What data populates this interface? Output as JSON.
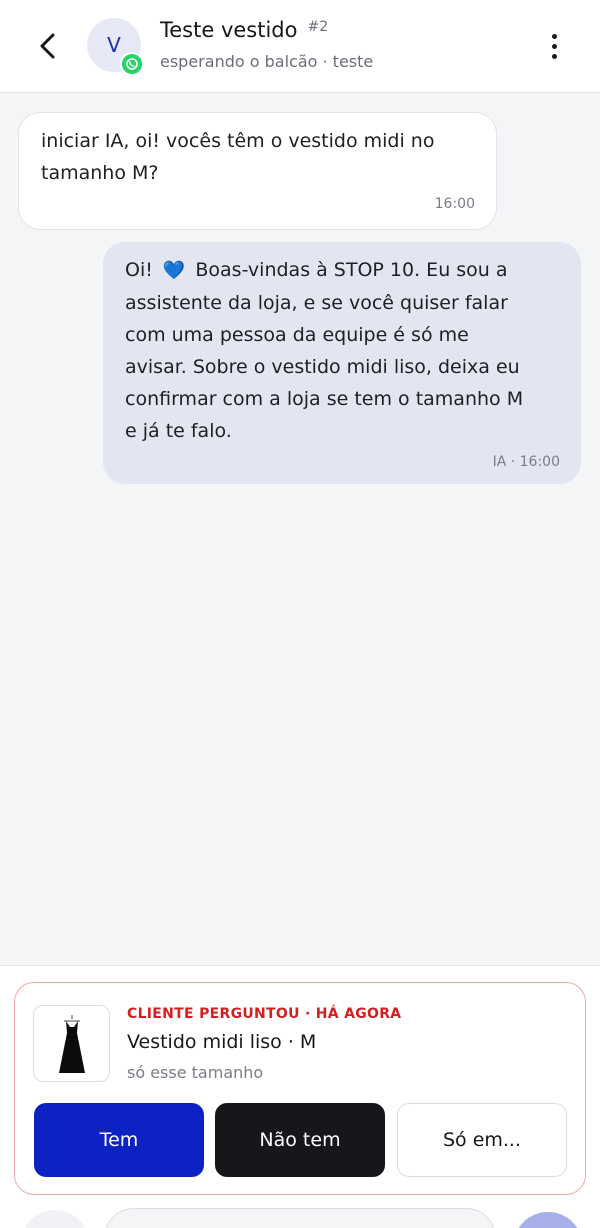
{
  "header": {
    "avatar_initial": "V",
    "channel_icon": "whatsapp-icon",
    "title": "Teste vestido",
    "ticket": "#2",
    "subtitle": "esperando o balcão · teste"
  },
  "messages": [
    {
      "direction": "incoming",
      "lines": [
        "iniciar IA, oi! vocês têm o vestido midi no",
        "tamanho M?"
      ],
      "time": "16:00"
    },
    {
      "direction": "outgoing",
      "first_line_prefix": "Oi!",
      "emoji": "💙",
      "first_line_suffix": "Boas-vindas à STOP 10. Eu sou a",
      "lines": [
        "assistente da loja, e se você quiser falar",
        "com uma pessoa da equipe é só me",
        "avisar. Sobre o vestido midi liso, deixa eu",
        "confirmar com a loja se tem o tamanho M",
        "e já te falo."
      ],
      "meta": "IA · 16:00"
    }
  ],
  "request_card": {
    "thumbnail_icon": "dress-icon",
    "alert": "CLIENTE PERGUNTOU · HÁ AGORA",
    "product": "Vestido midi liso · M",
    "note": "só esse tamanho",
    "actions": {
      "has_stock": "Tem",
      "no_stock": "Não tem",
      "only_in": "Só em..."
    }
  },
  "colors": {
    "accent": "#0d22c2",
    "alert": "#d51f1f",
    "whatsapp": "#25d366"
  }
}
